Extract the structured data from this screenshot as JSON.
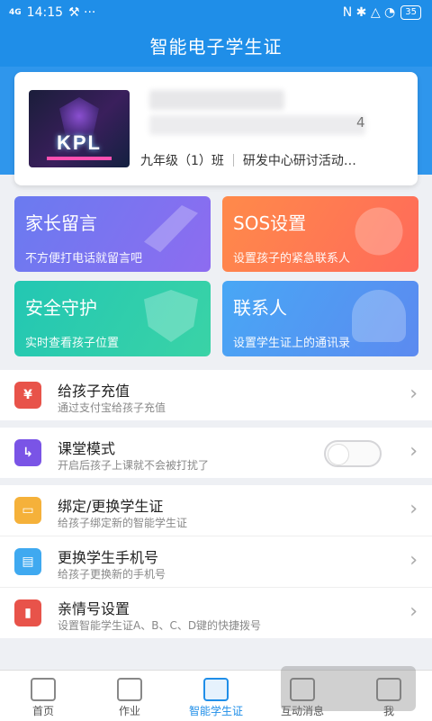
{
  "status": {
    "signal": "4G",
    "time": "14:15",
    "extras": "⚒ ···",
    "right_icons": "N ✱ △ ◔",
    "battery": "35"
  },
  "header": {
    "title": "智能电子学生证"
  },
  "profile": {
    "avatar_text": "KPL",
    "id_suffix": "4",
    "class_name": "九年级（1）班",
    "school": "研发中心研讨活动…"
  },
  "tiles": [
    {
      "title": "家长留言",
      "subtitle": "不方便打电话就留言吧"
    },
    {
      "title": "SOS设置",
      "subtitle": "设置孩子的紧急联系人"
    },
    {
      "title": "安全守护",
      "subtitle": "实时查看孩子位置"
    },
    {
      "title": "联系人",
      "subtitle": "设置学生证上的通讯录"
    }
  ],
  "list": [
    {
      "title": "给孩子充值",
      "subtitle": "通过支付宝给孩子充值",
      "icon_text": "¥",
      "color": "#e8534a"
    },
    {
      "title": "课堂模式",
      "subtitle": "开启后孩子上课就不会被打扰了",
      "icon_text": "↳",
      "color": "#7a54e6",
      "toggle_on": false
    },
    {
      "title": "绑定/更换学生证",
      "subtitle": "给孩子绑定新的智能学生证",
      "icon_text": "▭",
      "color": "#f5b13a"
    },
    {
      "title": "更换学生手机号",
      "subtitle": "给孩子更换新的手机号",
      "icon_text": "▤",
      "color": "#3fa9f0"
    },
    {
      "title": "亲情号设置",
      "subtitle": "设置智能学生证A、B、C、D键的快捷拨号",
      "icon_text": "▮",
      "color": "#e8534a"
    }
  ],
  "tabs": [
    {
      "label": "首页"
    },
    {
      "label": "作业"
    },
    {
      "label": "智能学生证",
      "active": true
    },
    {
      "label": "互动消息"
    },
    {
      "label": "我"
    }
  ],
  "chevron": "›",
  "accent_color": "#1f8ee8"
}
